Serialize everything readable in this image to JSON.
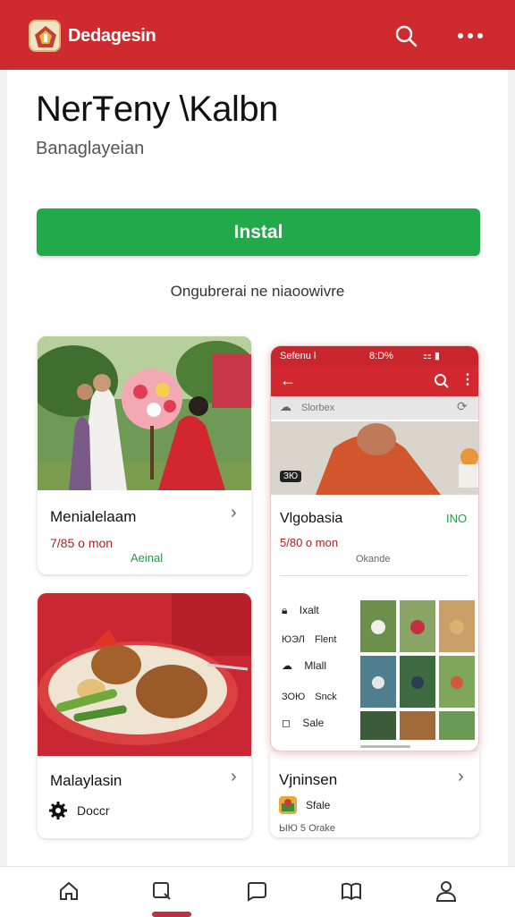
{
  "app": {
    "title": "Dedagesin"
  },
  "header": {
    "title": "Ner⁠Ŧeny \\Kalbn",
    "subtitle": "Banaglayeian"
  },
  "install": {
    "label": "Instal"
  },
  "subnote": "Ongubrerai ne niaoowivre",
  "cards": [
    {
      "title": "Menialelaam",
      "price": "7/85 o mon",
      "status": "Aeinal"
    },
    {
      "title": "Malaylasin",
      "meta": "Doccr"
    },
    {
      "title": "Vjninsen",
      "meta": "Sfale",
      "footer": "ЫЮ 5 Orake"
    }
  ],
  "phone": {
    "status_left": "Sefenu l",
    "status_time": "8:D%",
    "search_placeholder": "Slorbex",
    "badge": "ЗЮ",
    "title": "Vlgobasia",
    "price": "5/80 o mon",
    "flag": "INO",
    "sub": "Okande",
    "menu": [
      {
        "label": "Ixalt",
        "code": ""
      },
      {
        "label": "Flent",
        "code": "ЮЭЛ"
      },
      {
        "label": "Mlall",
        "code": ""
      },
      {
        "label": "Snck",
        "code": "ЗОЮ"
      },
      {
        "label": "Sale",
        "code": ""
      }
    ]
  },
  "colors": {
    "brand": "#cf2a2e",
    "install": "#22a94a",
    "price": "#b31d24"
  }
}
